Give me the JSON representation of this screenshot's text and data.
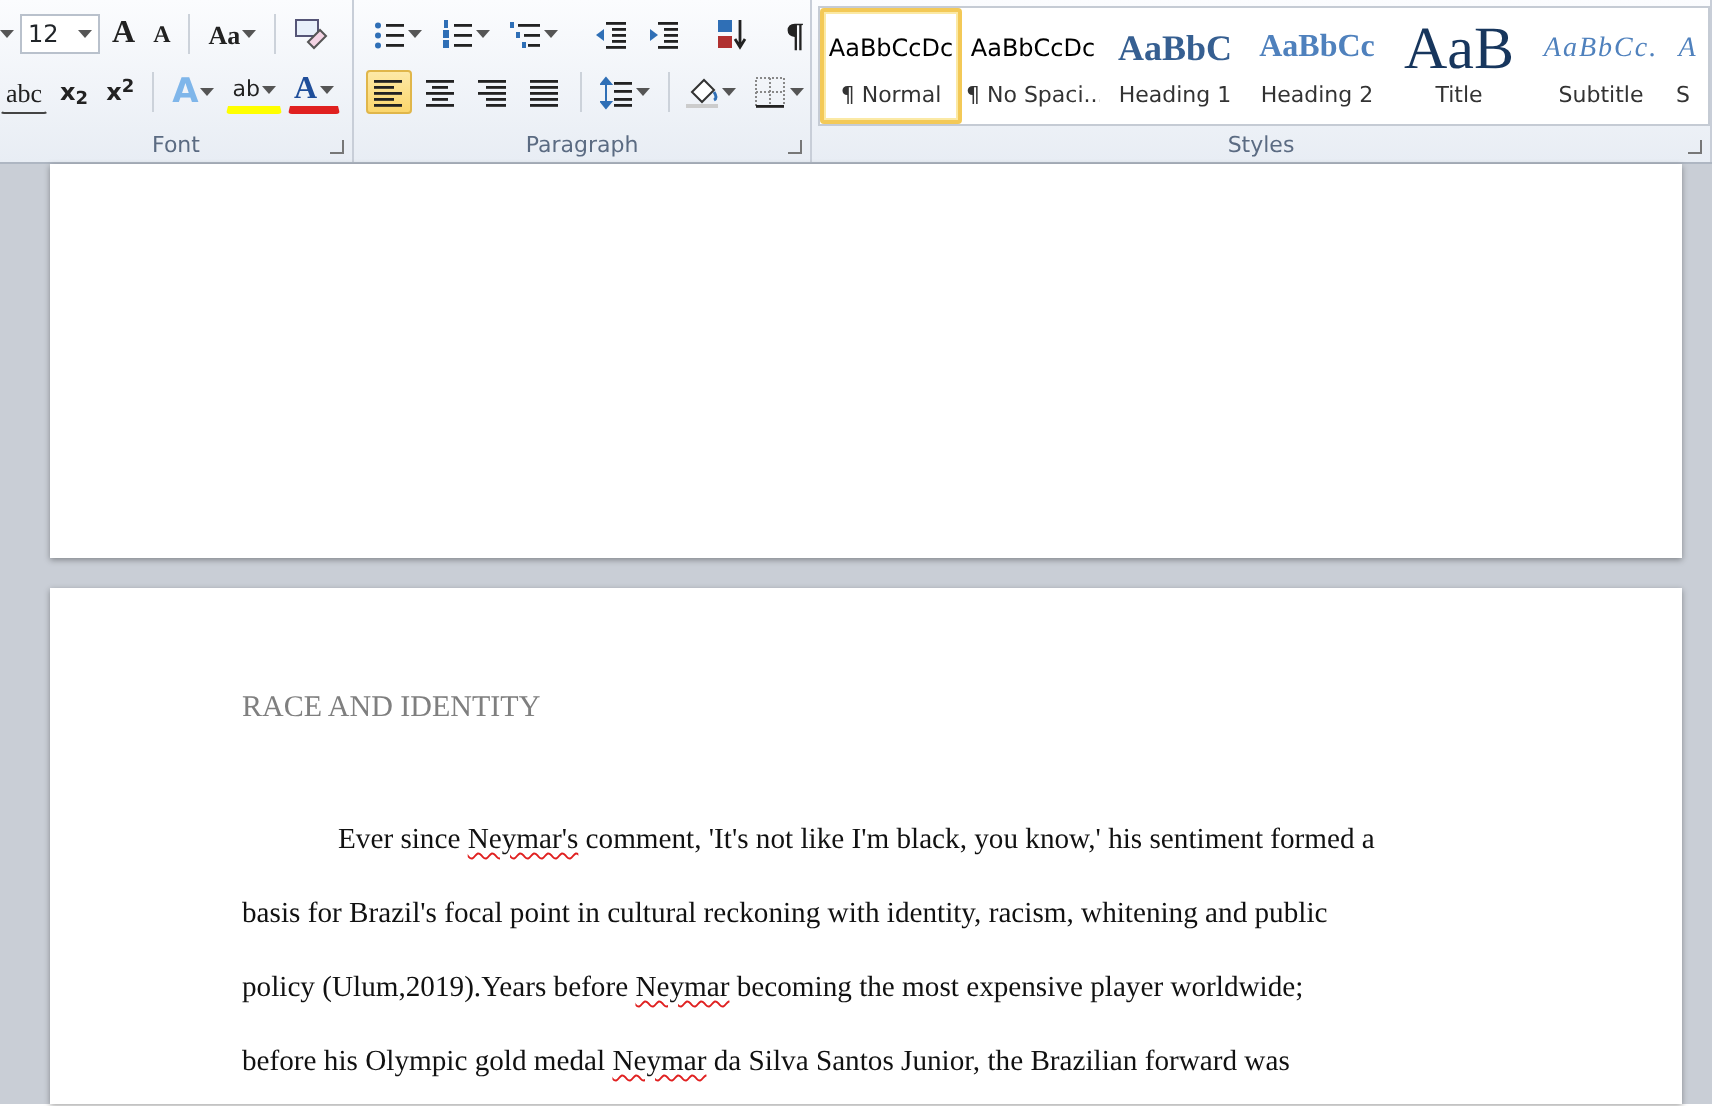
{
  "ribbon": {
    "font_group": {
      "label": "Font",
      "font_size": "12",
      "row1": [
        {
          "kind": "grow_font",
          "glyph": "A"
        },
        {
          "kind": "shrink_font",
          "glyph": "A"
        },
        {
          "kind": "change_case",
          "glyph": "Aa"
        },
        {
          "kind": "clear_formatting"
        }
      ],
      "row2": [
        {
          "kind": "strikethrough",
          "glyph": "abc"
        },
        {
          "kind": "subscript",
          "glyph": "x$_{2}$"
        },
        {
          "kind": "superscript",
          "glyph": "x$^{2}$"
        },
        {
          "kind": "text_effects",
          "glyph": "A"
        },
        {
          "kind": "highlight",
          "glyph": "ab"
        },
        {
          "kind": "font_color",
          "glyph": "A"
        }
      ]
    },
    "paragraph_group": {
      "label": "Paragraph",
      "row1": [
        {
          "kind": "bullets"
        },
        {
          "kind": "numbering"
        },
        {
          "kind": "multilevel"
        },
        {
          "kind": "decrease_indent"
        },
        {
          "kind": "increase_indent"
        },
        {
          "kind": "sort"
        },
        {
          "kind": "show_marks",
          "glyph": "¶"
        }
      ],
      "alignment": [
        {
          "kind": "left",
          "selected": true
        },
        {
          "kind": "center",
          "selected": false
        },
        {
          "kind": "right",
          "selected": false
        },
        {
          "kind": "justify",
          "selected": false
        }
      ],
      "row2": [
        {
          "kind": "line_spacing"
        },
        {
          "kind": "shading"
        },
        {
          "kind": "borders"
        }
      ]
    },
    "styles_group": {
      "label": "Styles",
      "items": [
        {
          "preview": "AaBbCcDc",
          "name": "¶ Normal",
          "kind": "normal",
          "selected": true
        },
        {
          "preview": "AaBbCcDc",
          "name": "¶ No Spaci...",
          "kind": "normal",
          "selected": false
        },
        {
          "preview": "AaBbC",
          "name": "Heading 1",
          "kind": "heading1",
          "selected": false
        },
        {
          "preview": "AaBbCc",
          "name": "Heading 2",
          "kind": "heading2",
          "selected": false
        },
        {
          "preview": "AaB",
          "name": "Title",
          "kind": "title",
          "selected": false
        },
        {
          "preview": "AaBbCc.",
          "name": "Subtitle",
          "kind": "subtitle",
          "selected": false
        },
        {
          "preview": "A",
          "name": "S",
          "kind": "subtitle",
          "selected": false
        }
      ]
    }
  },
  "document": {
    "heading": "RACE AND IDENTITY",
    "paragraph_lines": [
      [
        {
          "text": "Ever since ",
          "misspelled": false
        },
        {
          "text": "Neymar's",
          "misspelled": true
        },
        {
          "text": " comment, 'It's not like I'm black, you know,' his sentiment formed a",
          "misspelled": false
        }
      ],
      [
        {
          "text": "basis for Brazil's focal point in cultural reckoning with identity, racism, whitening and public",
          "misspelled": false
        }
      ],
      [
        {
          "text": "policy (Ulum,2019).Years before ",
          "misspelled": false
        },
        {
          "text": "Neymar",
          "misspelled": true
        },
        {
          "text": " becoming the most expensive player worldwide;",
          "misspelled": false
        }
      ],
      [
        {
          "text": "before his Olympic gold medal ",
          "misspelled": false
        },
        {
          "text": "Neymar",
          "misspelled": true
        },
        {
          "text": " da Silva Santos Junior, the Brazilian  forward was",
          "misspelled": false
        }
      ]
    ]
  }
}
